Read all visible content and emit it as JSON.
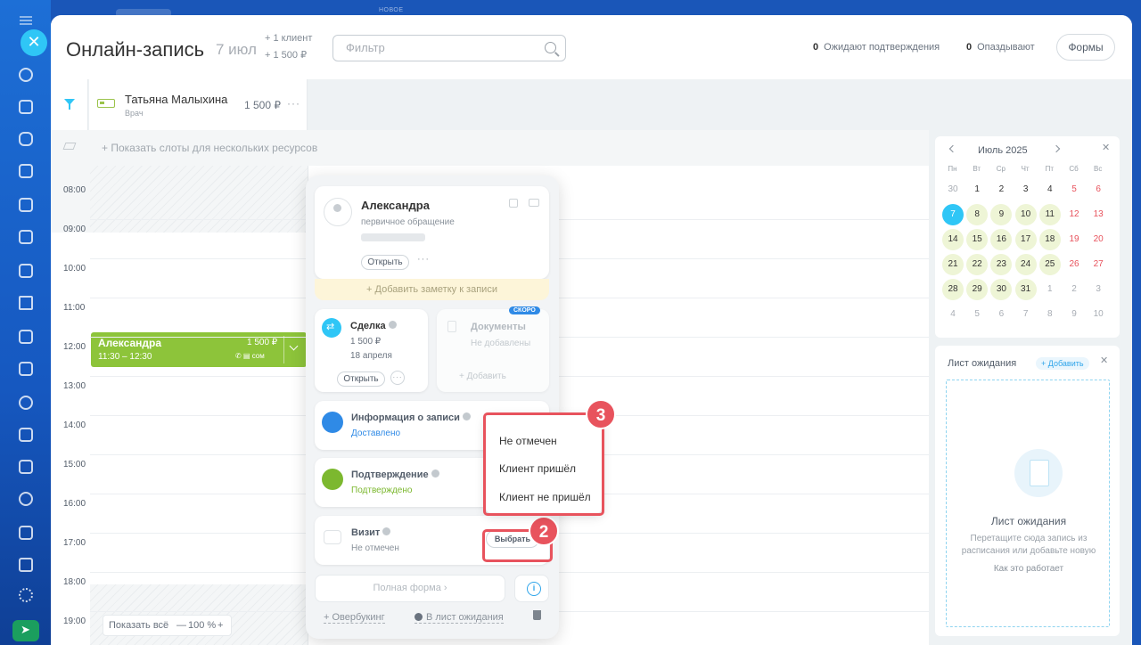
{
  "header": {
    "title": "Онлайн-запись",
    "date": "7 июл",
    "stat_clients": "+ 1 клиент",
    "stat_sum": "+ 1 500 ₽",
    "filter_placeholder": "Фильтр",
    "awaiting_count": "0",
    "awaiting_label": "Ожидают подтверждения",
    "late_count": "0",
    "late_label": "Опаздывают",
    "forms_label": "Формы"
  },
  "topbar": {
    "new_label": "НОВОЕ"
  },
  "resource": {
    "name": "Татьяна Малыхина",
    "role": "Врач",
    "price": "1 500 ₽",
    "more": "···"
  },
  "show_slots_label": "+ Показать слоты для нескольких ресурсов",
  "times": [
    "08:00",
    "09:00",
    "10:00",
    "11:00",
    "12:00",
    "13:00",
    "14:00",
    "15:00",
    "16:00",
    "17:00",
    "18:00",
    "19:00"
  ],
  "booking": {
    "name": "Александра",
    "time": "11:30 – 12:30",
    "price": "1 500 ₽",
    "icons": "✆ ▤ сом"
  },
  "zoom": {
    "show_all": "Показать всё",
    "minus": "—",
    "level": "100 %",
    "plus": "+"
  },
  "popup": {
    "client_name": "Александра",
    "client_sub": "первичное обращение",
    "open_label": "Открыть",
    "more": "···",
    "add_note": "+ Добавить заметку к записи",
    "deal_title": "Сделка",
    "deal_price": "1 500 ₽",
    "deal_date": "18 апреля",
    "deal_open": "Открыть",
    "docs_badge": "СКОРО",
    "docs_title": "Документы",
    "docs_sub": "Не добавлены",
    "docs_add": "+   Добавить",
    "info_title": "Информация о записи",
    "info_sub": "Доставлено",
    "confirm_title": "Подтверждение",
    "confirm_sub": "Подтверждено",
    "visit_title": "Визит",
    "visit_sub": "Не отмечен",
    "choose_label": "Выбрать",
    "full_form": "Полная форма  ›",
    "overbooking": "+ Овербукинг",
    "to_waitlist": "В лист ожидания"
  },
  "dropdown": {
    "items": [
      "Не отмечен",
      "Клиент пришёл",
      "Клиент не пришёл"
    ]
  },
  "callouts": {
    "badge2": "2",
    "badge3": "3"
  },
  "calendar": {
    "month": "Июль 2025",
    "close": "✕",
    "dow": [
      "Пн",
      "Вт",
      "Ср",
      "Чт",
      "Пт",
      "Сб",
      "Вс"
    ],
    "weeks": [
      [
        "30",
        "1",
        "2",
        "3",
        "4",
        "5",
        "6"
      ],
      [
        "7",
        "8",
        "9",
        "10",
        "11",
        "12",
        "13"
      ],
      [
        "14",
        "15",
        "16",
        "17",
        "18",
        "19",
        "20"
      ],
      [
        "21",
        "22",
        "23",
        "24",
        "25",
        "26",
        "27"
      ],
      [
        "28",
        "29",
        "30",
        "31",
        "1",
        "2",
        "3"
      ],
      [
        "4",
        "5",
        "6",
        "7",
        "8",
        "9",
        "10"
      ]
    ]
  },
  "waitlist": {
    "title": "Лист ожидания",
    "add": "+ Добавить",
    "close": "✕",
    "heading": "Лист ожидания",
    "desc": "Перетащите сюда запись из расписания или добавьте новую",
    "how": "Как это работает"
  },
  "colors": {
    "accent": "#2fc6f6",
    "booking": "#8dc43a",
    "callout": "#e8535d",
    "rail": "#1d6fd6"
  }
}
